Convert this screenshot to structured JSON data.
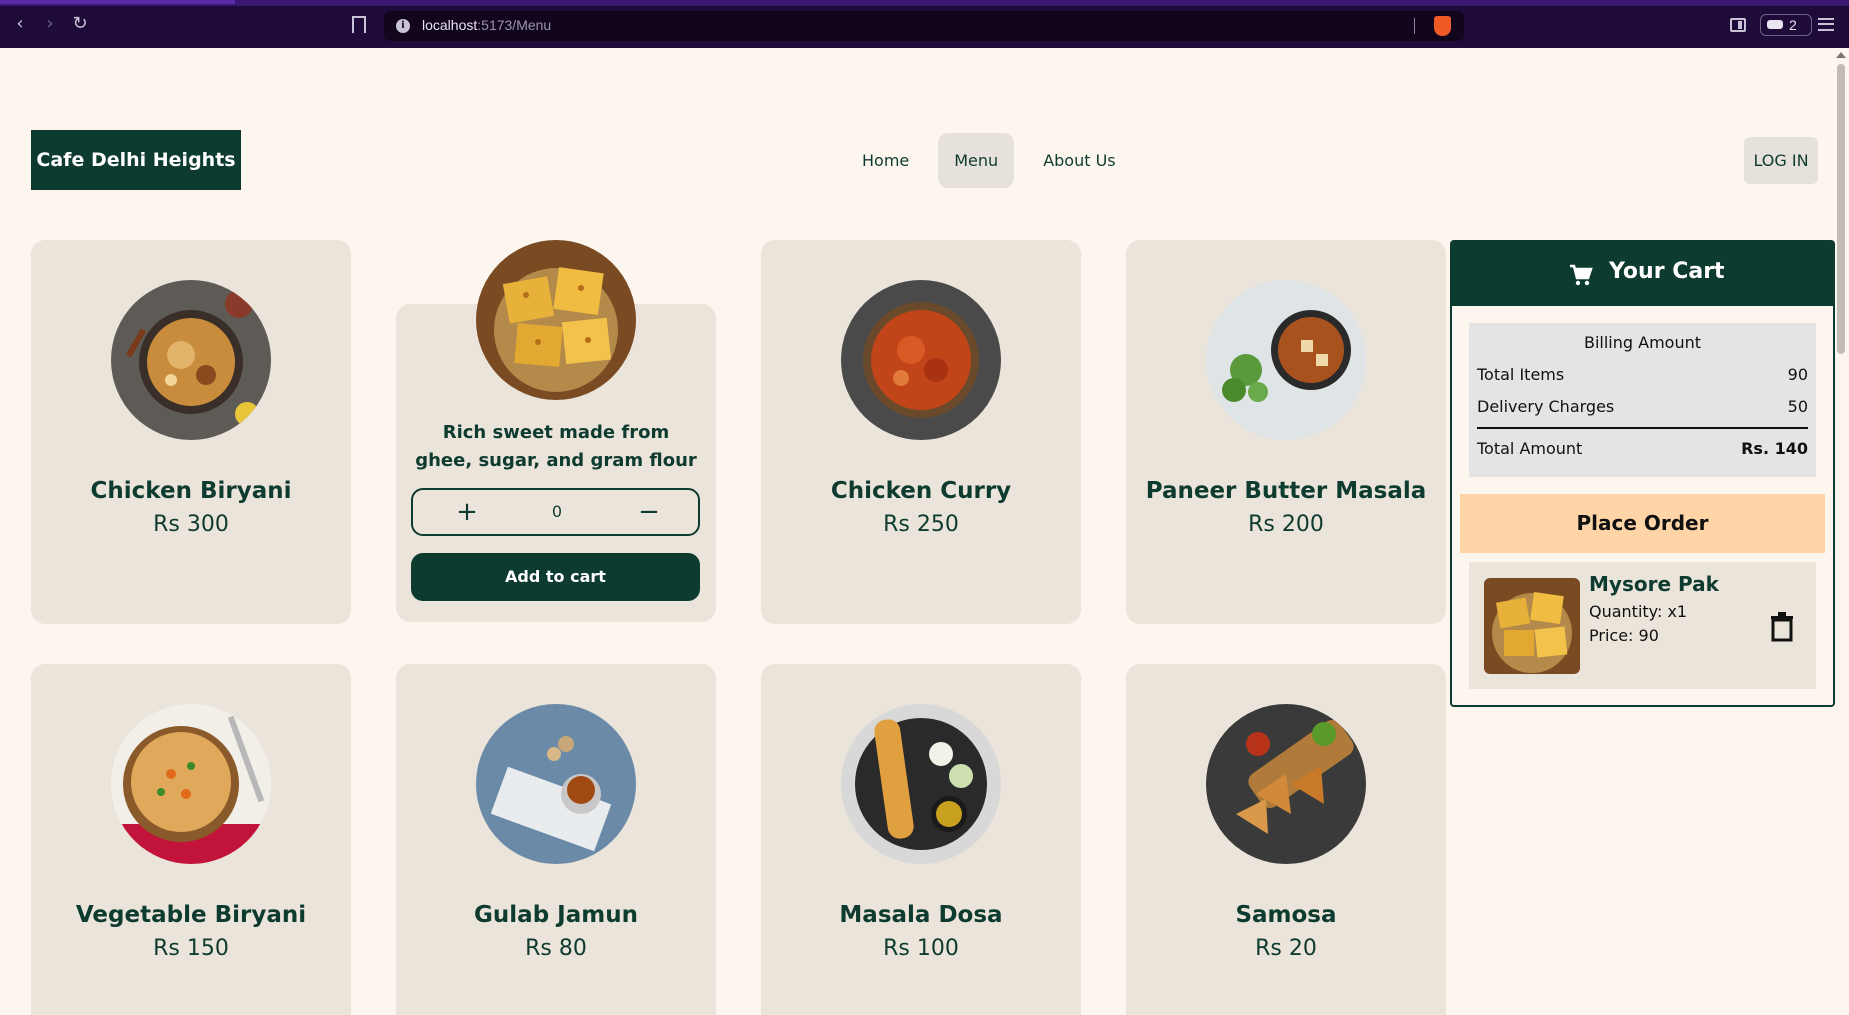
{
  "browser": {
    "url_host": "localhost",
    "url_path": ":5173/Menu",
    "wallet_count": "2"
  },
  "header": {
    "logo": "Cafe Delhi Heights",
    "nav": [
      "Home",
      "Menu",
      "About Us"
    ],
    "active_nav": "Menu",
    "login": "LOG IN"
  },
  "menu": {
    "items": [
      {
        "name": "Chicken Biryani",
        "price": "Rs 300",
        "image": "chicken-biryani"
      },
      {
        "name": "Mysore Pak",
        "price": "Rs 90",
        "image": "mysore-pak",
        "description": "Rich sweet made from ghee, sugar, and gram flour",
        "quantity": "0",
        "add_label": "Add to cart"
      },
      {
        "name": "Chicken Curry",
        "price": "Rs 250",
        "image": "chicken-curry"
      },
      {
        "name": "Paneer Butter Masala",
        "price": "Rs 200",
        "image": "paneer-butter-masala"
      },
      {
        "name": "Vegetable Biryani",
        "price": "Rs 150",
        "image": "vegetable-biryani"
      },
      {
        "name": "Gulab Jamun",
        "price": "Rs 80",
        "image": "gulab-jamun"
      },
      {
        "name": "Masala Dosa",
        "price": "Rs 100",
        "image": "masala-dosa"
      },
      {
        "name": "Samosa",
        "price": "Rs 20",
        "image": "samosa"
      }
    ]
  },
  "cart": {
    "title": "Your Cart",
    "billing_title": "Billing Amount",
    "total_items_label": "Total Items",
    "total_items_value": "90",
    "delivery_label": "Delivery Charges",
    "delivery_value": "50",
    "total_label": "Total Amount",
    "total_value": "Rs. 140",
    "place_order": "Place Order",
    "item": {
      "name": "Mysore Pak",
      "quantity": "Quantity: x1",
      "price": "Price: 90"
    }
  },
  "colors": {
    "brand": "#0e3b30",
    "background": "#fdf6ee",
    "card": "#ebe4db",
    "place_order": "#ffd5a8"
  }
}
